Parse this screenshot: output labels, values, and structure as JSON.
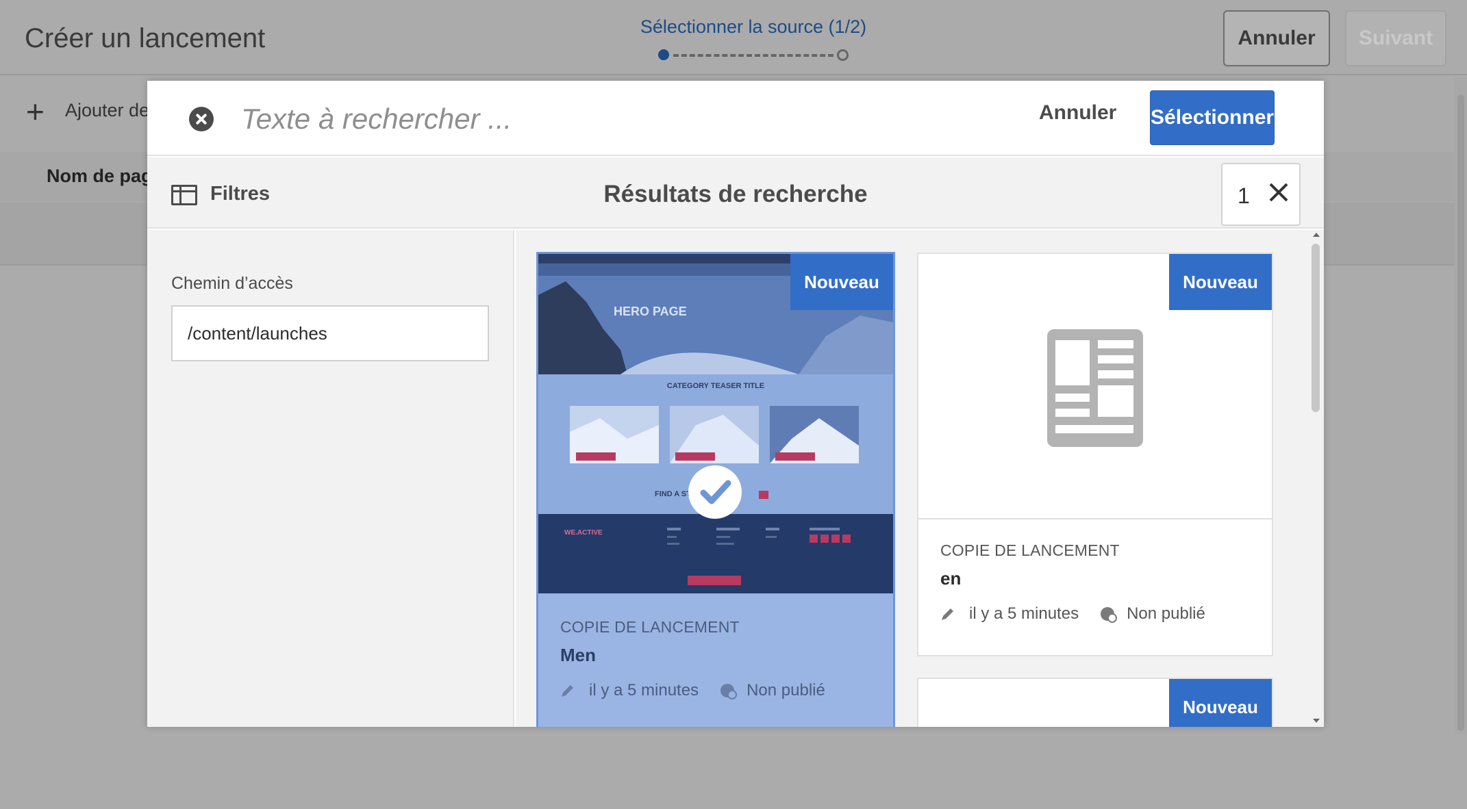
{
  "wizard": {
    "title": "Créer un lancement",
    "step_label": "Sélectionner la source (1/2)",
    "cancel_label": "Annuler",
    "next_label": "Suivant",
    "add_label": "Ajouter de",
    "column_page_name": "Nom de page"
  },
  "modal": {
    "search_placeholder": "Texte à rechercher ...",
    "cancel_label": "Annuler",
    "select_label": "Sélectionner",
    "filters_label": "Filtres",
    "results_title": "Résultats de recherche",
    "selected_count": "1",
    "path_label": "Chemin d’accès",
    "path_value": "/content/launches"
  },
  "cards": [
    {
      "badge": "Nouveau",
      "type": "COPIE DE LANCEMENT",
      "name": "Men",
      "modified": "il y a 5 minutes",
      "status": "Non publié",
      "selected": true,
      "thumbnail": {
        "hero_text": "HERO PAGE",
        "teaser_title": "CATEGORY TEASER TITLE",
        "find_text": "FIND A ST",
        "brand": "WE.ACTIVE"
      }
    },
    {
      "badge": "Nouveau",
      "type": "COPIE DE LANCEMENT",
      "name": "en",
      "modified": "il y a 5 minutes",
      "status": "Non publié",
      "selected": false
    },
    {
      "badge": "Nouveau"
    }
  ],
  "colors": {
    "accent": "#326ec8",
    "selected_card": "#9ab5e3",
    "overlay": "#ababab"
  }
}
